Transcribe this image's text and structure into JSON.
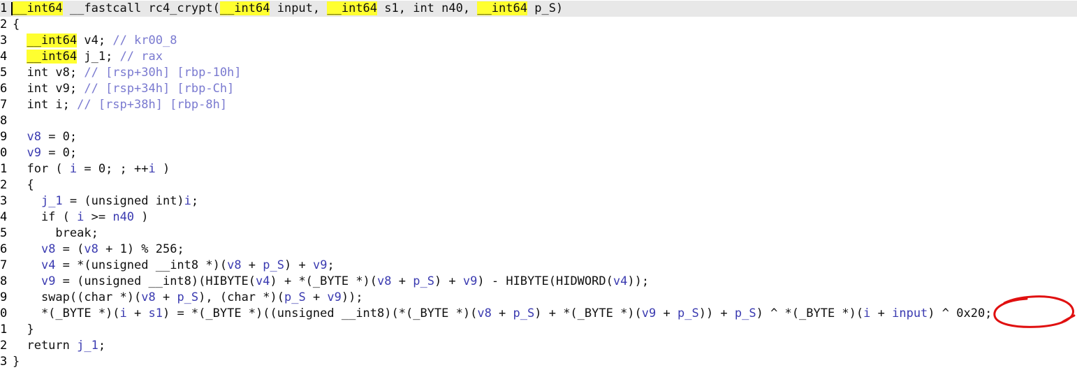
{
  "editor": {
    "lines": [
      {
        "num": "1",
        "current": true,
        "tokens": [
          {
            "t": "__int64",
            "c": "hl"
          },
          {
            "t": " __fastcall rc4_crypt(",
            "c": "plain"
          },
          {
            "t": "__int64",
            "c": "hl"
          },
          {
            "t": " input, ",
            "c": "plain"
          },
          {
            "t": "__int64",
            "c": "hl"
          },
          {
            "t": " s1, int n40, ",
            "c": "plain"
          },
          {
            "t": "__int64",
            "c": "hl"
          },
          {
            "t": " p_S)",
            "c": "plain"
          }
        ]
      },
      {
        "num": "2",
        "tokens": [
          {
            "t": "{",
            "c": "plain"
          }
        ]
      },
      {
        "num": "3",
        "tokens": [
          {
            "t": "  ",
            "c": "plain"
          },
          {
            "t": "__int64",
            "c": "hl"
          },
          {
            "t": " v4; ",
            "c": "plain"
          },
          {
            "t": "// kr00_8",
            "c": "cmt"
          }
        ]
      },
      {
        "num": "4",
        "tokens": [
          {
            "t": "  ",
            "c": "plain"
          },
          {
            "t": "__int64",
            "c": "hl"
          },
          {
            "t": " j_1; ",
            "c": "plain"
          },
          {
            "t": "// rax",
            "c": "cmt"
          }
        ]
      },
      {
        "num": "5",
        "tokens": [
          {
            "t": "  int v8; ",
            "c": "plain"
          },
          {
            "t": "// [rsp+30h] [rbp-10h]",
            "c": "cmt"
          }
        ]
      },
      {
        "num": "6",
        "tokens": [
          {
            "t": "  int v9; ",
            "c": "plain"
          },
          {
            "t": "// [rsp+34h] [rbp-Ch]",
            "c": "cmt"
          }
        ]
      },
      {
        "num": "7",
        "tokens": [
          {
            "t": "  int i; ",
            "c": "plain"
          },
          {
            "t": "// [rsp+38h] [rbp-8h]",
            "c": "cmt"
          }
        ]
      },
      {
        "num": "8",
        "tokens": []
      },
      {
        "num": "9",
        "tokens": [
          {
            "t": "  ",
            "c": "plain"
          },
          {
            "t": "v8",
            "c": "var"
          },
          {
            "t": " = 0;",
            "c": "plain"
          }
        ]
      },
      {
        "num": "0",
        "tokens": [
          {
            "t": "  ",
            "c": "plain"
          },
          {
            "t": "v9",
            "c": "var"
          },
          {
            "t": " = 0;",
            "c": "plain"
          }
        ]
      },
      {
        "num": "1",
        "tokens": [
          {
            "t": "  for ( ",
            "c": "plain"
          },
          {
            "t": "i",
            "c": "var"
          },
          {
            "t": " = 0; ; ++",
            "c": "plain"
          },
          {
            "t": "i",
            "c": "var"
          },
          {
            "t": " )",
            "c": "plain"
          }
        ]
      },
      {
        "num": "2",
        "tokens": [
          {
            "t": "  {",
            "c": "plain"
          }
        ]
      },
      {
        "num": "3",
        "tokens": [
          {
            "t": "    ",
            "c": "plain"
          },
          {
            "t": "j_1",
            "c": "var"
          },
          {
            "t": " = (unsigned int)",
            "c": "plain"
          },
          {
            "t": "i",
            "c": "var"
          },
          {
            "t": ";",
            "c": "plain"
          }
        ]
      },
      {
        "num": "4",
        "tokens": [
          {
            "t": "    if ( ",
            "c": "plain"
          },
          {
            "t": "i",
            "c": "var"
          },
          {
            "t": " >= ",
            "c": "plain"
          },
          {
            "t": "n40",
            "c": "var"
          },
          {
            "t": " )",
            "c": "plain"
          }
        ]
      },
      {
        "num": "5",
        "tokens": [
          {
            "t": "      break;",
            "c": "plain"
          }
        ]
      },
      {
        "num": "6",
        "tokens": [
          {
            "t": "    ",
            "c": "plain"
          },
          {
            "t": "v8",
            "c": "var"
          },
          {
            "t": " = (",
            "c": "plain"
          },
          {
            "t": "v8",
            "c": "var"
          },
          {
            "t": " + 1) % 256;",
            "c": "plain"
          }
        ]
      },
      {
        "num": "7",
        "tokens": [
          {
            "t": "    ",
            "c": "plain"
          },
          {
            "t": "v4",
            "c": "var"
          },
          {
            "t": " = *(unsigned __int8 *)(",
            "c": "plain"
          },
          {
            "t": "v8",
            "c": "var"
          },
          {
            "t": " + ",
            "c": "plain"
          },
          {
            "t": "p_S",
            "c": "var"
          },
          {
            "t": ") + ",
            "c": "plain"
          },
          {
            "t": "v9",
            "c": "var"
          },
          {
            "t": ";",
            "c": "plain"
          }
        ]
      },
      {
        "num": "8",
        "tokens": [
          {
            "t": "    ",
            "c": "plain"
          },
          {
            "t": "v9",
            "c": "var"
          },
          {
            "t": " = (unsigned __int8)(HIBYTE(",
            "c": "plain"
          },
          {
            "t": "v4",
            "c": "var"
          },
          {
            "t": ") + *(_BYTE *)(",
            "c": "plain"
          },
          {
            "t": "v8",
            "c": "var"
          },
          {
            "t": " + ",
            "c": "plain"
          },
          {
            "t": "p_S",
            "c": "var"
          },
          {
            "t": ") + ",
            "c": "plain"
          },
          {
            "t": "v9",
            "c": "var"
          },
          {
            "t": ") - HIBYTE(HIDWORD(",
            "c": "plain"
          },
          {
            "t": "v4",
            "c": "var"
          },
          {
            "t": "));",
            "c": "plain"
          }
        ]
      },
      {
        "num": "9",
        "tokens": [
          {
            "t": "    swap((char *)(",
            "c": "plain"
          },
          {
            "t": "v8",
            "c": "var"
          },
          {
            "t": " + ",
            "c": "plain"
          },
          {
            "t": "p_S",
            "c": "var"
          },
          {
            "t": "), (char *)(",
            "c": "plain"
          },
          {
            "t": "p_S",
            "c": "var"
          },
          {
            "t": " + ",
            "c": "plain"
          },
          {
            "t": "v9",
            "c": "var"
          },
          {
            "t": "));",
            "c": "plain"
          }
        ]
      },
      {
        "num": "0",
        "tokens": [
          {
            "t": "    *(_BYTE *)(",
            "c": "plain"
          },
          {
            "t": "i",
            "c": "var"
          },
          {
            "t": " + ",
            "c": "plain"
          },
          {
            "t": "s1",
            "c": "var"
          },
          {
            "t": ") = *(_BYTE *)((unsigned __int8)(*(_BYTE *)(",
            "c": "plain"
          },
          {
            "t": "v8",
            "c": "var"
          },
          {
            "t": " + ",
            "c": "plain"
          },
          {
            "t": "p_S",
            "c": "var"
          },
          {
            "t": ") + *(_BYTE *)(",
            "c": "plain"
          },
          {
            "t": "v9",
            "c": "var"
          },
          {
            "t": " + ",
            "c": "plain"
          },
          {
            "t": "p_S",
            "c": "var"
          },
          {
            "t": ")) + ",
            "c": "plain"
          },
          {
            "t": "p_S",
            "c": "var"
          },
          {
            "t": ") ^ *(_BYTE *)(",
            "c": "plain"
          },
          {
            "t": "i",
            "c": "var"
          },
          {
            "t": " + ",
            "c": "plain"
          },
          {
            "t": "input",
            "c": "var"
          },
          {
            "t": ") ^ 0x20;",
            "c": "plain"
          }
        ]
      },
      {
        "num": "1",
        "tokens": [
          {
            "t": "  }",
            "c": "plain"
          }
        ]
      },
      {
        "num": "2",
        "tokens": [
          {
            "t": "  return ",
            "c": "plain"
          },
          {
            "t": "j_1",
            "c": "var"
          },
          {
            "t": ";",
            "c": "plain"
          }
        ]
      },
      {
        "num": "3",
        "tokens": [
          {
            "t": "}",
            "c": "plain"
          }
        ]
      }
    ]
  },
  "colors": {
    "keyword_highlight": "#ffff30",
    "variable": "#3a3ab0",
    "comment": "#7a7ad0",
    "current_line": "#e8e8e8",
    "annotation": "#e01010"
  }
}
